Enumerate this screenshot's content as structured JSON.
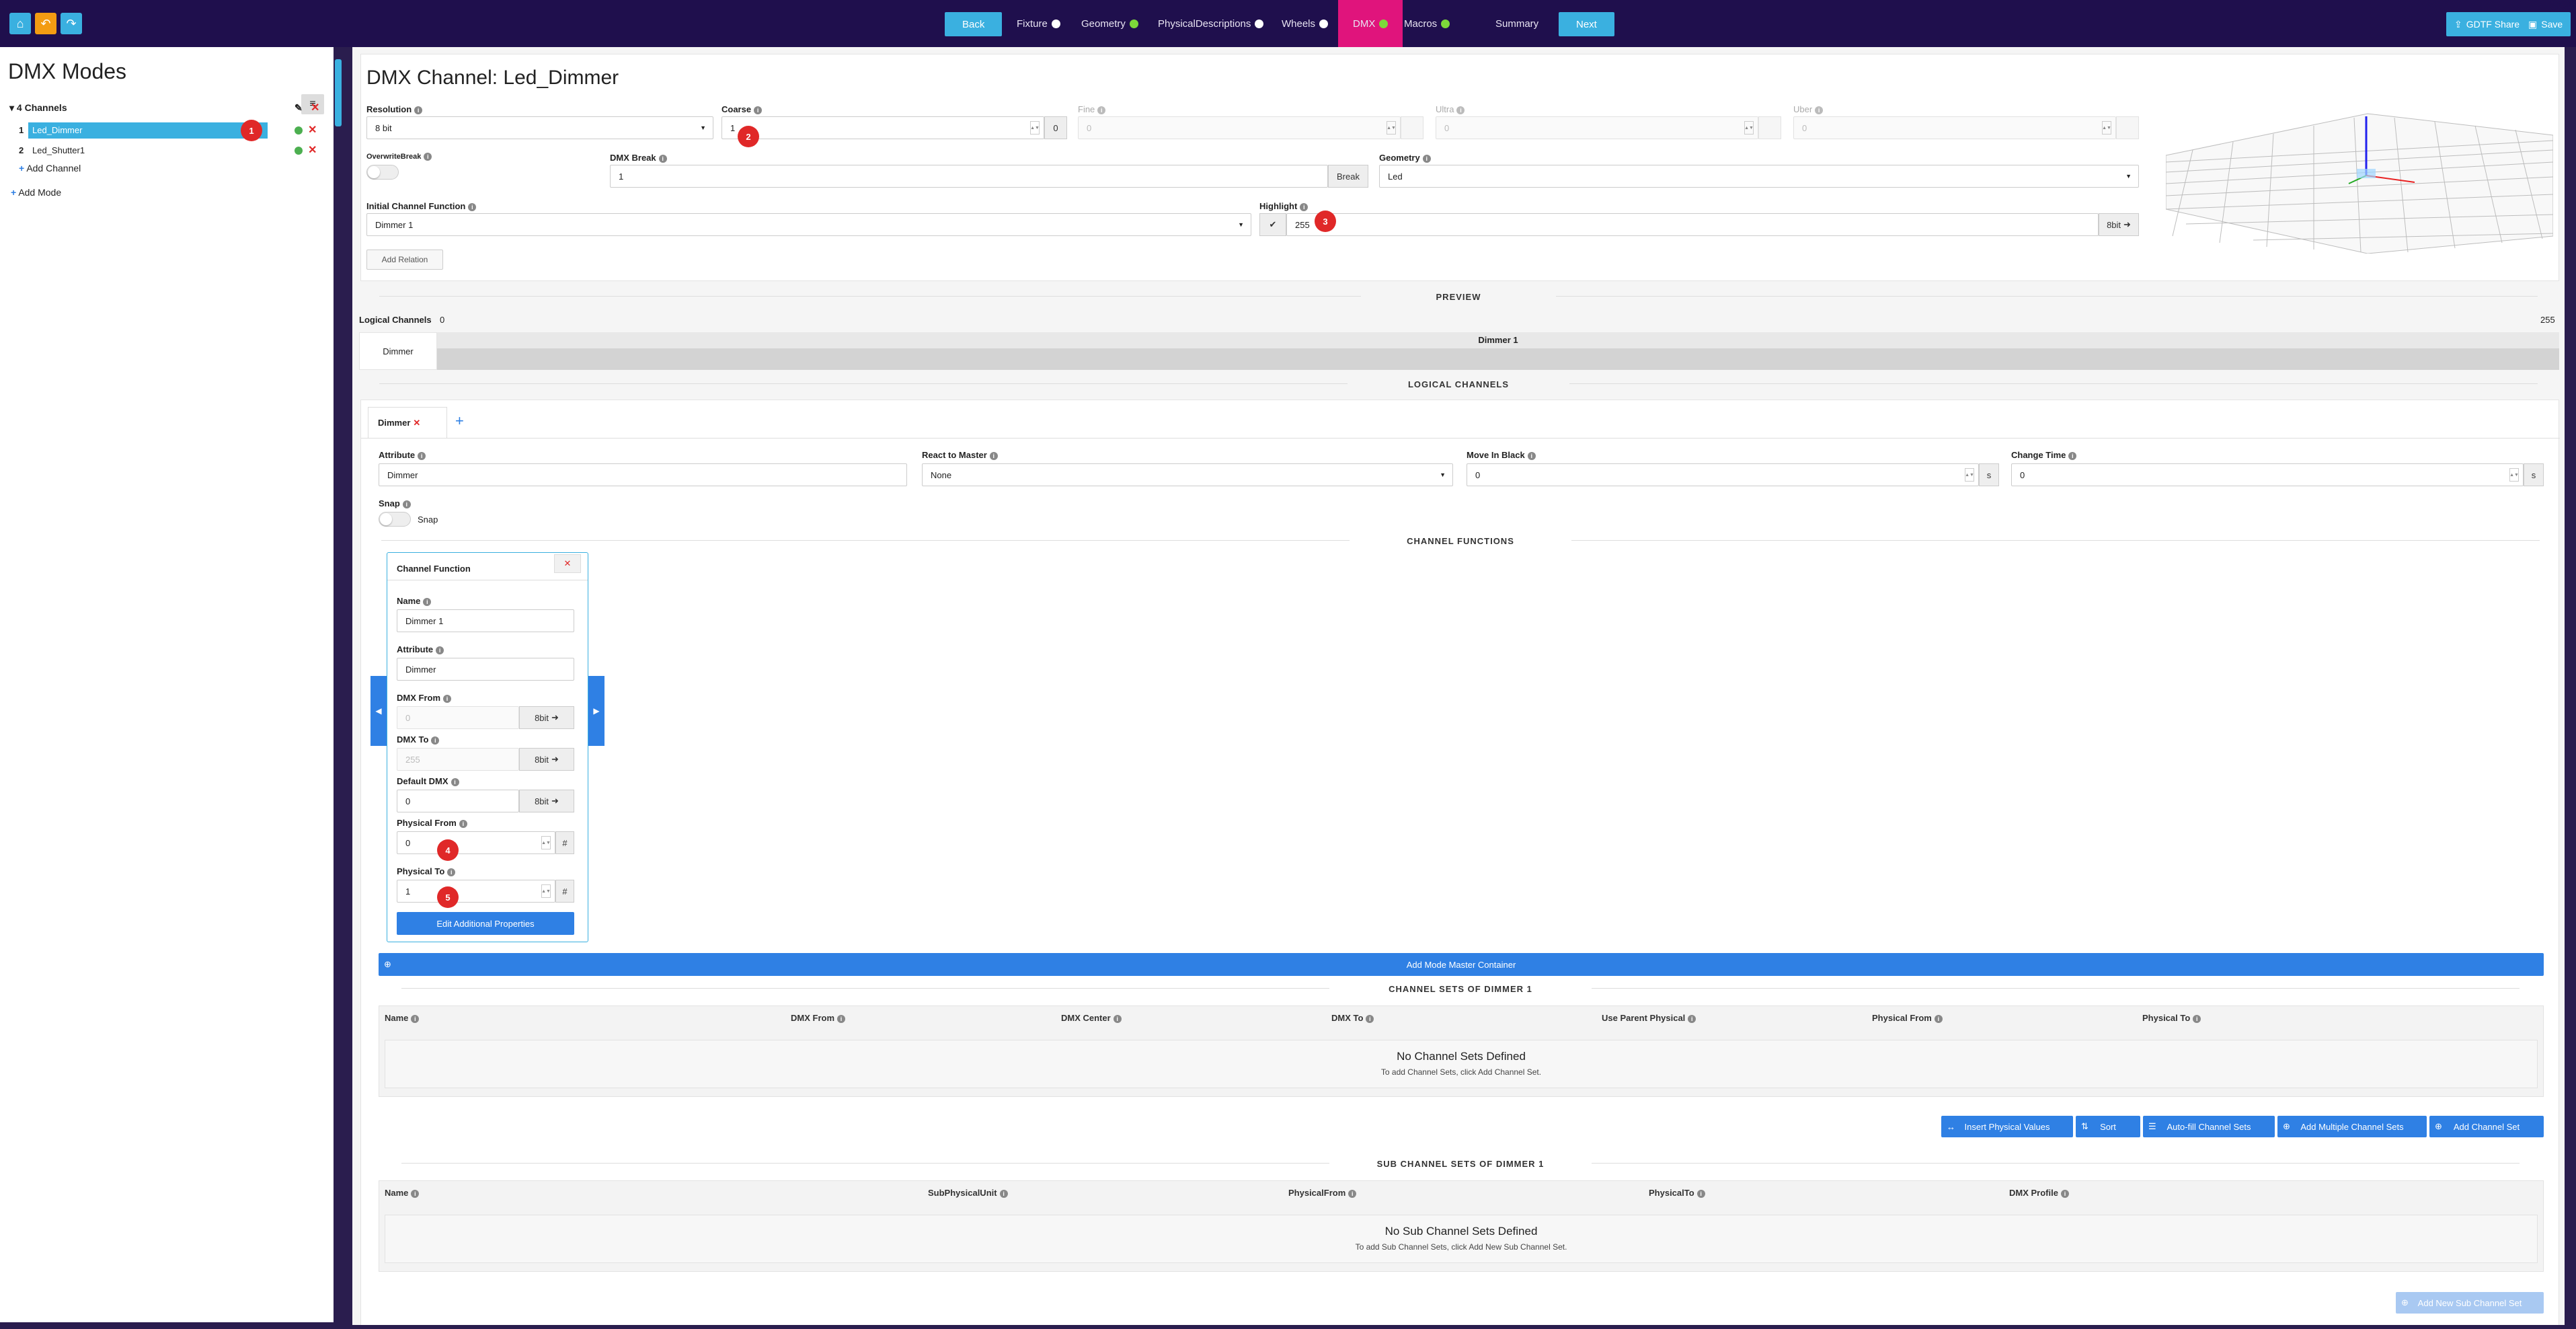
{
  "topbar": {
    "home_icon": "home-icon",
    "undo_icon": "undo-icon",
    "redo_icon": "redo-icon",
    "back_label": "Back",
    "next_label": "Next",
    "nav": [
      {
        "label": "Fixture",
        "dot": "#ffffff"
      },
      {
        "label": "Geometry",
        "dot": "#7dd83a"
      },
      {
        "label": "PhysicalDescriptions",
        "dot": "#ffffff"
      },
      {
        "label": "Wheels",
        "dot": "#ffffff"
      },
      {
        "label": "DMX",
        "dot": "#7dd83a"
      },
      {
        "label": "Macros",
        "dot": "#7dd83a"
      },
      {
        "label": "Summary"
      }
    ],
    "share_label": "GDTF Share",
    "save_label": "Save"
  },
  "sidebar": {
    "title": "DMX Modes",
    "mode_label": "4 Channels",
    "channels": [
      {
        "num": "1",
        "name": "Led_Dimmer"
      },
      {
        "num": "2",
        "name": "Led_Shutter1"
      }
    ],
    "add_channel": "Add Channel",
    "add_mode": "Add Mode"
  },
  "channel": {
    "title": "DMX Channel: Led_Dimmer",
    "resolution_label": "Resolution",
    "resolution_value": "8 bit",
    "coarse_label": "Coarse",
    "coarse_value": "1",
    "coarse_addon": "0",
    "fine_label": "Fine",
    "fine_value": "0",
    "ultra_label": "Ultra",
    "ultra_value": "0",
    "uber_label": "Uber",
    "uber_value": "0",
    "override_label": "OverwriteBreak",
    "dmxbreak_label": "DMX Break",
    "dmxbreak_value": "1",
    "break_btn": "Break",
    "geometry_label": "Geometry",
    "geometry_value": "Led",
    "initial_label": "Initial Channel Function",
    "initial_value": "Dimmer 1",
    "highlight_label": "Highlight",
    "highlight_value": "255",
    "highlight_unit": "8bit",
    "add_relation": "Add Relation"
  },
  "preview": {
    "title": "PREVIEW",
    "logical_label": "Logical Channels",
    "min": "0",
    "max": "255",
    "row_label": "Dimmer",
    "function_label": "Dimmer 1"
  },
  "logical": {
    "title": "LOGICAL CHANNELS",
    "tab_label": "Dimmer",
    "attribute_label": "Attribute",
    "attribute_value": "Dimmer",
    "react_label": "React to Master",
    "react_value": "None",
    "moveblack_label": "Move In Black",
    "moveblack_value": "0",
    "moveblack_unit": "s",
    "change_label": "Change Time",
    "change_value": "0",
    "change_unit": "s",
    "snap_label": "Snap",
    "snap_toggle_label": "Snap"
  },
  "functions": {
    "title": "CHANNEL FUNCTIONS",
    "card_title": "Channel Function",
    "name_label": "Name",
    "name_value": "Dimmer 1",
    "attr_label": "Attribute",
    "attr_value": "Dimmer",
    "from_label": "DMX From",
    "from_value": "0",
    "from_unit": "8bit",
    "to_label": "DMX To",
    "to_value": "255",
    "to_unit": "8bit",
    "default_label": "Default DMX",
    "default_value": "0",
    "default_unit": "8bit",
    "pfrom_label": "Physical From",
    "pfrom_value": "0",
    "pfrom_unit": "#",
    "pto_label": "Physical To",
    "pto_value": "1",
    "pto_unit": "#",
    "edit_btn": "Edit Additional Properties",
    "add_master": "Add Mode Master Container"
  },
  "channel_sets": {
    "title": "CHANNEL SETS OF DIMMER 1",
    "headers": [
      "Name",
      "DMX From",
      "DMX Center",
      "DMX To",
      "Use Parent Physical",
      "Physical From",
      "Physical To"
    ],
    "empty_title": "No Channel Sets Defined",
    "empty_sub": "To add Channel Sets, click Add Channel Set.",
    "buttons": [
      "Insert Physical Values",
      "Sort",
      "Auto-fill Channel Sets",
      "Add Multiple Channel Sets",
      "Add Channel Set"
    ]
  },
  "sub_sets": {
    "title": "SUB CHANNEL SETS OF DIMMER 1",
    "headers": [
      "Name",
      "SubPhysicalUnit",
      "PhysicalFrom",
      "PhysicalTo",
      "DMX Profile"
    ],
    "empty_title": "No Sub Channel Sets Defined",
    "empty_sub": "To add Sub Channel Sets, click Add New Sub Channel Set.",
    "add_btn": "Add New Sub Channel Set"
  },
  "badges": [
    "1",
    "2",
    "3",
    "4",
    "5"
  ]
}
